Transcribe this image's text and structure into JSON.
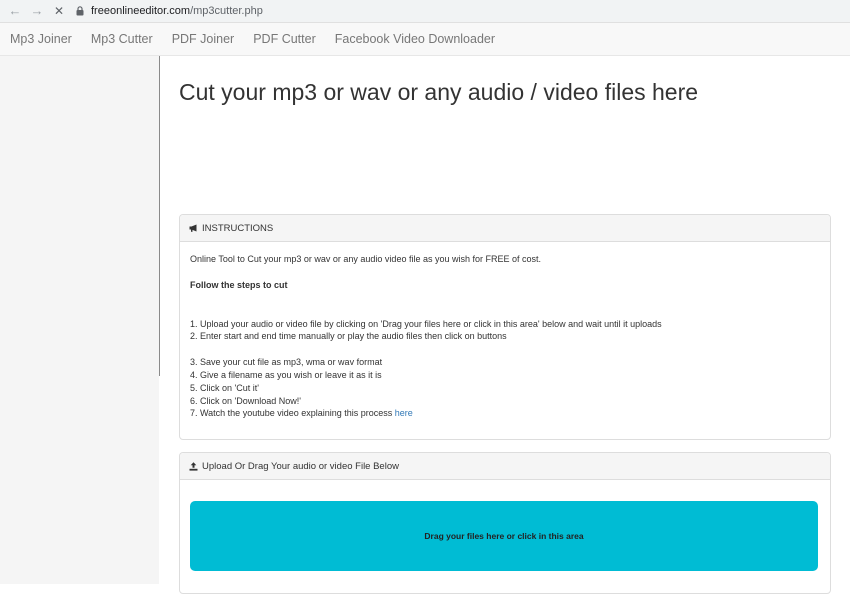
{
  "browser": {
    "back_icon": "←",
    "forward_icon": "→",
    "reload_icon": "✕",
    "url_host": "freeonlineeditor.com",
    "url_path": "/mp3cutter.php"
  },
  "nav": {
    "items": [
      "Mp3 Joiner",
      "Mp3 Cutter",
      "PDF Joiner",
      "PDF Cutter",
      "Facebook Video Downloader"
    ]
  },
  "main": {
    "heading": "Cut your mp3 or wav or any audio / video files here"
  },
  "instructions": {
    "header": "INSTRUCTIONS",
    "intro": "Online Tool to Cut your mp3 or wav or any audio video file as you wish for FREE of cost.",
    "steps_title": "Follow the steps to cut",
    "steps": [
      "1. Upload your audio or video file by clicking on 'Drag your files here or click in this area' below and wait until it uploads",
      "2. Enter start and end time manually or play the audio files then click on buttons",
      "3. Save your cut file as mp3, wma or wav format",
      "4. Give a filename as you wish or leave it as it is",
      "5. Click on 'Cut it'",
      "6. Click on 'Download Now!'",
      "7. Watch the youtube video explaining this process "
    ],
    "here_link": "here"
  },
  "upload": {
    "header": "Upload Or Drag Your audio or video File Below",
    "dropzone_text": "Drag your files here or click in this area"
  },
  "colors": {
    "dropzone": "#00bcd4",
    "link": "#337ab7"
  }
}
